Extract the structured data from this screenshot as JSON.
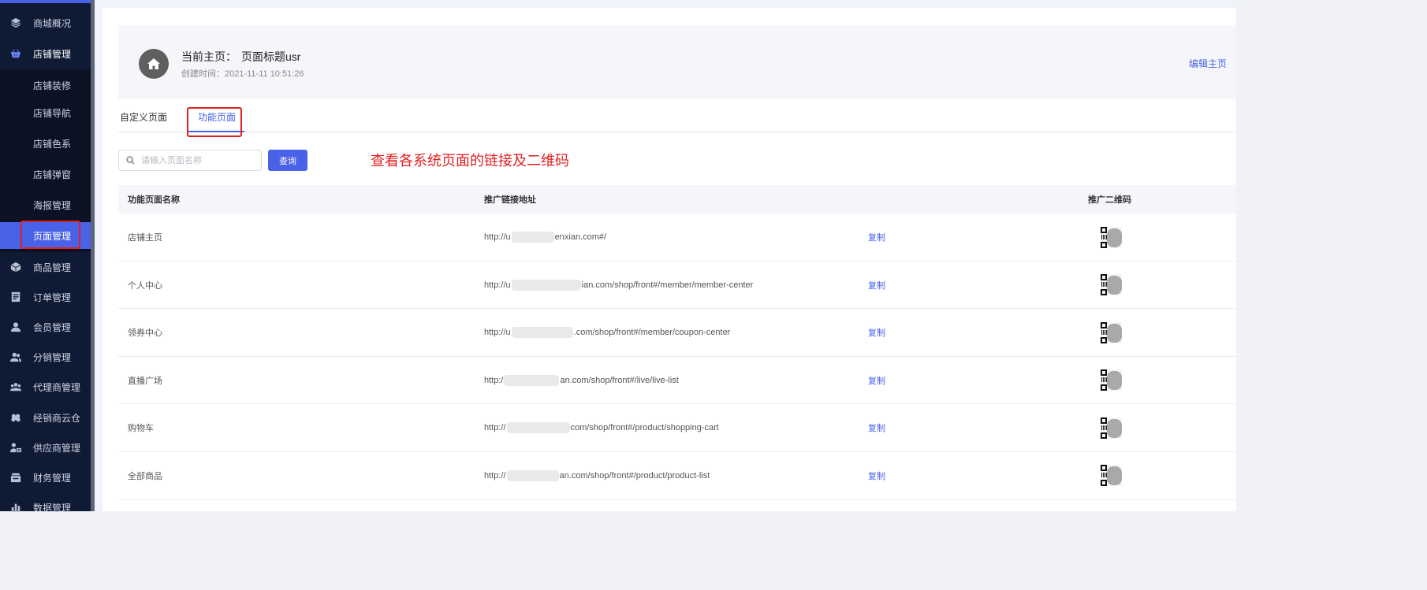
{
  "sidebar": {
    "items": [
      {
        "label": "商城概况",
        "icon": "layers-icon"
      },
      {
        "label": "店铺管理",
        "icon": "basket-icon",
        "open": true
      },
      {
        "label": "商品管理",
        "icon": "box-icon"
      },
      {
        "label": "订单管理",
        "icon": "document-icon"
      },
      {
        "label": "会员管理",
        "icon": "user-icon"
      },
      {
        "label": "分销管理",
        "icon": "users-icon"
      },
      {
        "label": "代理商管理",
        "icon": "group-icon"
      },
      {
        "label": "经销商云仓",
        "icon": "cloud-icon"
      },
      {
        "label": "供应商管理",
        "icon": "supplier-icon"
      },
      {
        "label": "财务管理",
        "icon": "wallet-icon"
      },
      {
        "label": "数据管理",
        "icon": "bar-chart-icon"
      }
    ],
    "subitems": [
      {
        "label": "店铺装修"
      },
      {
        "label": "店铺导航"
      },
      {
        "label": "店铺色系"
      },
      {
        "label": "店铺弹窗"
      },
      {
        "label": "海报管理"
      },
      {
        "label": "页面管理",
        "active": true
      }
    ]
  },
  "header": {
    "current_label": "当前主页：",
    "page_title": "页面标题usr",
    "created_label": "创建时间：",
    "created_time": "2021-11-11 10:51:26",
    "edit_label": "编辑主页"
  },
  "tabs": [
    {
      "label": "自定义页面"
    },
    {
      "label": "功能页面",
      "active": true
    }
  ],
  "search": {
    "placeholder": "请输入页面名称",
    "button_label": "查询"
  },
  "annotation": "查看各系统页面的链接及二维码",
  "table": {
    "headers": {
      "name": "功能页面名称",
      "link": "推广链接地址",
      "qr": "推广二维码"
    },
    "copy_label": "复制",
    "rows": [
      {
        "name": "店铺主页",
        "link_prefix": "http://u",
        "link_suffix": "enxian.com#/"
      },
      {
        "name": "个人中心",
        "link_prefix": "http://u",
        "link_suffix": "ian.com/shop/front#/member/member-center"
      },
      {
        "name": "领券中心",
        "link_prefix": "http://u",
        "link_suffix": ".com/shop/front#/member/coupon-center"
      },
      {
        "name": "直播广场",
        "link_prefix": "http:/",
        "link_suffix": "an.com/shop/front#/live/live-list"
      },
      {
        "name": "购物车",
        "link_prefix": "http://",
        "link_suffix": "com/shop/front#/product/shopping-cart"
      },
      {
        "name": "全部商品",
        "link_prefix": "http://",
        "link_suffix": "an.com/shop/front#/product/product-list"
      }
    ]
  },
  "colors": {
    "accent": "#4a62e8",
    "sidebar_bg": "#0f1b35",
    "annotation": "#e02020"
  }
}
